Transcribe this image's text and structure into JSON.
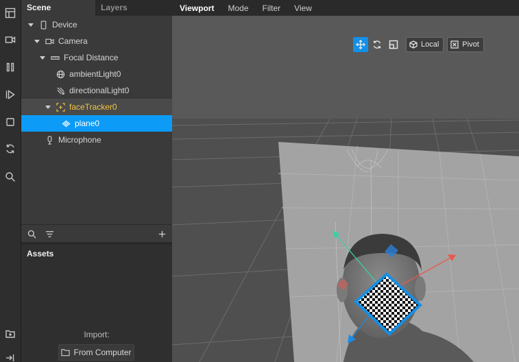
{
  "toolbar": {
    "tools": [
      "layout-icon",
      "camera-record-icon",
      "pause-icon",
      "play-step-icon",
      "stop-icon",
      "refresh-icon",
      "search-icon",
      "add-frame-icon",
      "export-icon"
    ]
  },
  "scene": {
    "tabs": [
      {
        "label": "Scene",
        "active": true
      },
      {
        "label": "Layers",
        "active": false
      }
    ],
    "tree": [
      {
        "label": "Device",
        "icon": "device-icon"
      },
      {
        "label": "Camera",
        "icon": "camera-icon"
      },
      {
        "label": "Focal Distance",
        "icon": "ruler-icon"
      },
      {
        "label": "ambientLight0",
        "icon": "globe-light-icon"
      },
      {
        "label": "directionalLight0",
        "icon": "directional-light-icon"
      },
      {
        "label": "faceTracker0",
        "icon": "face-tracker-icon"
      },
      {
        "label": "plane0",
        "icon": "plane-icon"
      },
      {
        "label": "Microphone",
        "icon": "microphone-icon"
      }
    ]
  },
  "assets": {
    "title": "Assets",
    "import_label": "Import:",
    "from_computer_label": "From Computer"
  },
  "viewport": {
    "menu": [
      {
        "label": "Viewport",
        "active": true
      },
      {
        "label": "Mode",
        "active": false
      },
      {
        "label": "Filter",
        "active": false
      },
      {
        "label": "View",
        "active": false
      }
    ],
    "transform_tools": [
      "move-icon",
      "rotate-icon",
      "scale-icon"
    ],
    "local_label": "Local",
    "pivot_label": "Pivot"
  },
  "colors": {
    "accent": "#0c9bf6",
    "highlight": "#f4c542",
    "axis_x": "#e8584c",
    "axis_y": "#3ad0a6",
    "axis_z": "#1a8ce8"
  }
}
